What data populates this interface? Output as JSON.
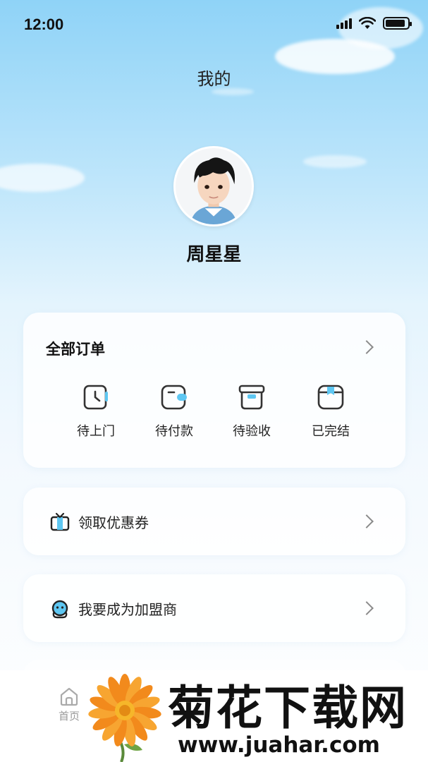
{
  "status_bar": {
    "time": "12:00",
    "battery_level": 0.9
  },
  "header": {
    "title": "我的"
  },
  "profile": {
    "name": "周星星"
  },
  "orders": {
    "title": "全部订单",
    "items": [
      {
        "label": "待上门",
        "icon": "clock-icon"
      },
      {
        "label": "待付款",
        "icon": "wallet-icon"
      },
      {
        "label": "待验收",
        "icon": "box-icon"
      },
      {
        "label": "已完结",
        "icon": "completed-box-icon"
      }
    ]
  },
  "menu": [
    {
      "label": "领取优惠券",
      "icon": "gift-icon"
    },
    {
      "label": "我要成为加盟商",
      "icon": "headset-icon"
    }
  ],
  "tabbar": {
    "home_label": "首页"
  },
  "watermark": {
    "title": "菊花下载网",
    "url": "www.juahar.com"
  },
  "colors": {
    "accent": "#5ec7f2",
    "icon_stroke": "#333333"
  }
}
